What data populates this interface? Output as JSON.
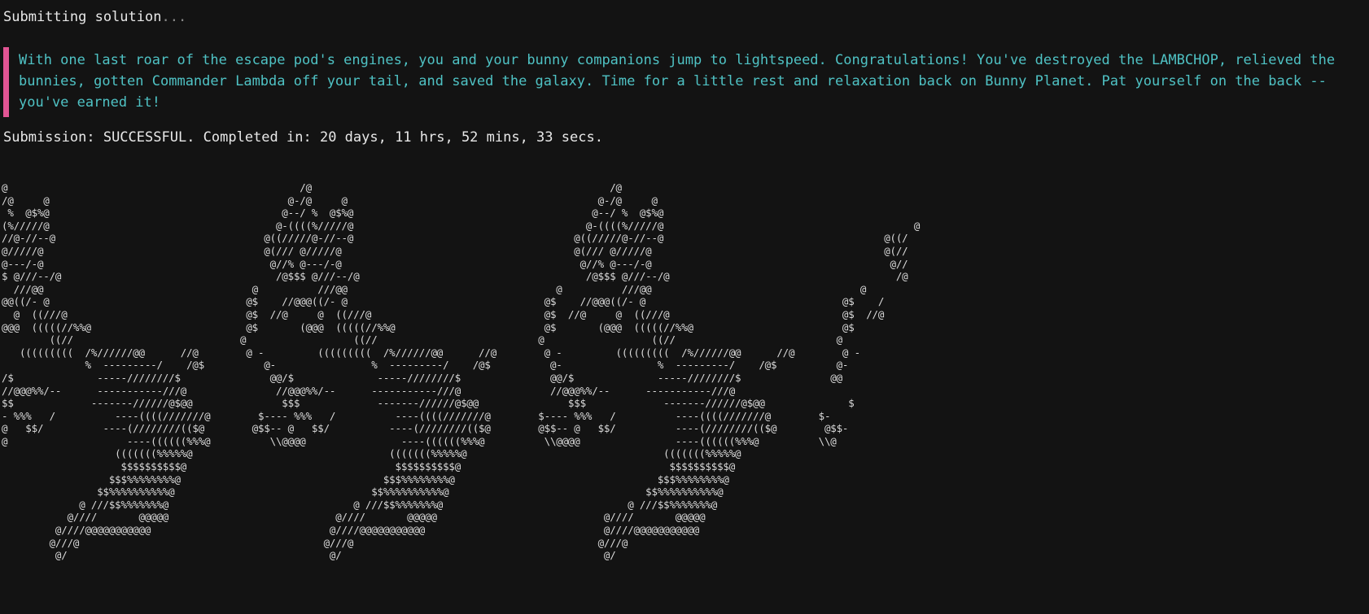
{
  "status": {
    "text": "Submitting solution",
    "ellipsis": "..."
  },
  "message": {
    "text": "With one last roar of the escape pod's engines, you and your bunny companions jump to lightspeed. Congratulations! You've destroyed the LAMBCHOP, relieved the bunnies, gotten Commander Lambda off your tail, and saved the galaxy. Time for a little rest and relaxation back on Bunny Planet. Pat yourself on the back -- you've earned it!"
  },
  "submission": {
    "label": "Submission: ",
    "result": "SUCCESSFUL",
    "completed_label": ". Completed in: ",
    "duration": "20 days, 11 hrs, 52 mins, 33 secs",
    "end": "."
  },
  "ascii_art": "@                                                 /@                                                  /@\n/@     @                                        @-/@     @                                          @-/@     @\n %  @$%@                                       @--/ %  @$%@                                        @--/ %  @$%@\n(%/////@                                      @-((((%/////@                                       @-((((%/////@                                          @\n//@-//--@                                   @((/////@-//--@                                     @((/////@-//--@                                     @((/\n@/////@                                     @(/// @/////@                                       @(/// @/////@                                       @(//\n@---/-@                                      @//% @---/-@                                        @//% @---/-@                                        @//\n$ @///--/@                                    /@$$$ @///--/@                                      /@$$$ @///--/@                                      /@\n  ///@@                                   @          ///@@                                   @          ///@@                                   @\n@@((/- @                                 @$    //@@@((/- @                                 @$    //@@@((/- @                                 @$    /\n  @  ((///@                              @$  //@     @  ((///@                             @$  //@     @  ((///@                             @$  //@\n@@@  (((((//%%@                          @$       (@@@  (((((//%%@                         @$       (@@@  (((((//%%@                         @$\n        ((//                            @                  ((//                           @                  ((//                           @\n   (((((((((  /%//////@@      //@        @ -         (((((((((  /%//////@@      //@        @ -         (((((((((  /%//////@@      //@        @ -\n              %  ---------/    /@$          @-                %  ---------/    /@$          @-                %  ---------/    /@$          @-\n/$              -----////////$               @@/$              -----////////$               @@/$              -----////////$               @@\n//@@@%%/--      -----------///@               //@@@%%/--      -----------///@               //@@@%%/--      -----------///@\n$$             -------//////@$@@               $$$             -------//////@$@@               $$$             -------//////@$@@              $\n- %%%   /          ----((((///////@        $---- %%%   /          ----((((///////@        $---- %%%   /          ----((((///////@        $-\n@   $$/          ----(////////(($@        @$$-- @   $$/          ----(////////(($@        @$$-- @   $$/          ----(////////(($@        @$$-\n@                    ----((((((%%%@          \\\\@@@@                ----((((((%%%@          \\\\@@@@                ----((((((%%%@          \\\\@\n                   (((((((%%%%%@                                 (((((((%%%%%@                                 (((((((%%%%%@\n                    $$$$$$$$$$@                                   $$$$$$$$$$@                                   $$$$$$$$$$@\n                  $$$%%%%%%%%@                                  $$$%%%%%%%%@                                  $$$%%%%%%%%@\n                $$%%%%%%%%%%@                                 $$%%%%%%%%%%@                                 $$%%%%%%%%%%@\n             @ ///$$%%%%%%%@                               @ ///$$%%%%%%%@                               @ ///$$%%%%%%%@\n           @////       @@@@@                            @////       @@@@@                            @////       @@@@@\n         @////@@@@@@@@@@@                              @////@@@@@@@@@@@                              @////@@@@@@@@@@@\n        @///@                                         @///@                                         @///@\n         @/                                            @/                                            @/"
}
